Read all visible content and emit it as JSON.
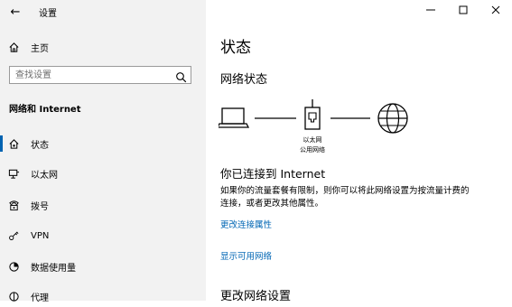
{
  "window": {
    "title": "设置"
  },
  "sidebar": {
    "home_label": "主页",
    "search_placeholder": "查找设置",
    "section_title": "网络和 Internet",
    "items": [
      {
        "label": "状态",
        "icon": "home-network-icon"
      },
      {
        "label": "以太网",
        "icon": "ethernet-icon"
      },
      {
        "label": "拨号",
        "icon": "dialup-icon"
      },
      {
        "label": "VPN",
        "icon": "vpn-icon"
      },
      {
        "label": "数据使用量",
        "icon": "data-usage-icon"
      },
      {
        "label": "代理",
        "icon": "proxy-icon"
      }
    ]
  },
  "main": {
    "page_title": "状态",
    "network_status_heading": "网络状态",
    "diagram": {
      "adapter_label_1": "以太网",
      "adapter_label_2": "公用网络"
    },
    "connected_title": "你已连接到 Internet",
    "description_line1": "如果你的流量套餐有限制，则你可以将此网络设置为按流量计费的",
    "description_line2": "连接，或者更改其他属性。",
    "link_change_properties": "更改连接属性",
    "link_show_networks": "显示可用网络",
    "change_settings_heading": "更改网络设置"
  },
  "colors": {
    "accent": "#0063b1",
    "link": "#0066b4",
    "sidebar_bg": "#f2f2f2"
  }
}
